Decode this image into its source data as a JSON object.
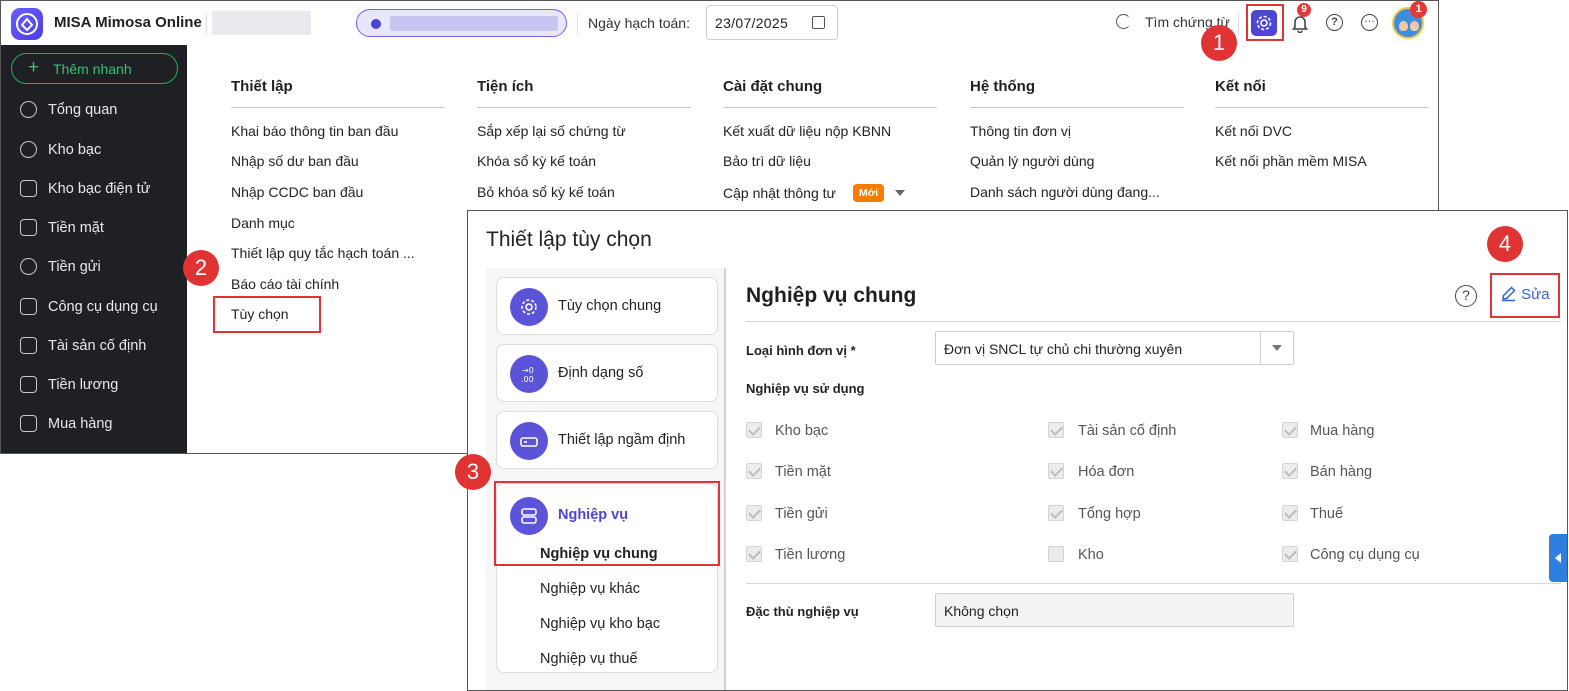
{
  "app": {
    "title": "MISA Mimosa Online"
  },
  "topbar": {
    "date_label": "Ngày hạch toán:",
    "date_value": "23/07/2025",
    "search_label": "Tìm chứng từ",
    "notification_count": "9",
    "avatar_badge": "1",
    "accent_color": "#4d45d4"
  },
  "sidebar": {
    "add_label": "Thêm nhanh",
    "items": [
      {
        "label": "Tổng quan",
        "icon": "pie-chart-icon"
      },
      {
        "label": "Kho bạc",
        "icon": "treasury-icon"
      },
      {
        "label": "Kho bạc điện tử",
        "icon": "e-treasury-icon"
      },
      {
        "label": "Tiền mặt",
        "icon": "cash-icon"
      },
      {
        "label": "Tiền gửi",
        "icon": "deposit-icon"
      },
      {
        "label": "Công cụ dụng cụ",
        "icon": "tools-icon"
      },
      {
        "label": "Tài sản cố định",
        "icon": "fixed-asset-icon"
      },
      {
        "label": "Tiền lương",
        "icon": "salary-icon"
      },
      {
        "label": "Mua hàng",
        "icon": "cart-icon"
      }
    ]
  },
  "menu": {
    "columns": [
      {
        "title": "Thiết lập",
        "items": [
          "Khai báo thông tin ban đầu",
          "Nhập số dư ban đầu",
          "Nhập CCDC ban đầu",
          "Danh mục",
          "Thiết lập quy tắc hạch toán ...",
          "Báo cáo tài chính",
          "Tùy chọn"
        ]
      },
      {
        "title": "Tiện ích",
        "items": [
          "Sắp xếp lại số chứng từ",
          "Khóa sổ kỳ kế toán",
          "Bỏ khóa sổ kỳ kế toán"
        ]
      },
      {
        "title": "Cài đặt chung",
        "items": [
          "Kết xuất dữ liệu nộp KBNN",
          "Bảo trì dữ liệu",
          "Cập nhật thông tư"
        ],
        "new_tag": "Mới"
      },
      {
        "title": "Hệ thống",
        "items": [
          "Thông tin đơn vị",
          "Quản lý người dùng",
          "Danh sách người dùng đang..."
        ]
      },
      {
        "title": "Kết nối",
        "items": [
          "Kết nối DVC",
          "Kết nối phần mềm MISA"
        ]
      }
    ]
  },
  "steps": [
    "1",
    "2",
    "3",
    "4"
  ],
  "dialog": {
    "title": "Thiết lập tùy chọn",
    "nav": {
      "cards": [
        "Tùy chọn chung",
        "Định dạng số",
        "Thiết lập ngầm định"
      ],
      "group_label": "Nghiệp vụ",
      "sub_items": [
        "Nghiệp vụ chung",
        "Nghiệp vụ khác",
        "Nghiệp vụ kho bạc",
        "Nghiệp vụ thuế"
      ]
    },
    "section_title": "Nghiệp vụ chung",
    "edit_label": "Sửa",
    "unit_type_label": "Loại hình đơn vị *",
    "unit_type_value": "Đơn vị SNCL tự chủ chi thường xuyên",
    "used_ops_label": "Nghiệp vụ sử dụng",
    "checkboxes": [
      {
        "label": "Kho bạc",
        "checked": true
      },
      {
        "label": "Tài sản cố định",
        "checked": true
      },
      {
        "label": "Mua hàng",
        "checked": true
      },
      {
        "label": "Tiền mặt",
        "checked": true
      },
      {
        "label": "Hóa đơn",
        "checked": true
      },
      {
        "label": "Bán hàng",
        "checked": true
      },
      {
        "label": "Tiền gửi",
        "checked": true
      },
      {
        "label": "Tổng hợp",
        "checked": true
      },
      {
        "label": "Thuế",
        "checked": true
      },
      {
        "label": "Tiền lương",
        "checked": true
      },
      {
        "label": "Kho",
        "checked": false
      },
      {
        "label": "Công cụ dụng cụ",
        "checked": true
      }
    ],
    "special_label": "Đặc thù nghiệp vụ",
    "special_value": "Không chọn"
  }
}
